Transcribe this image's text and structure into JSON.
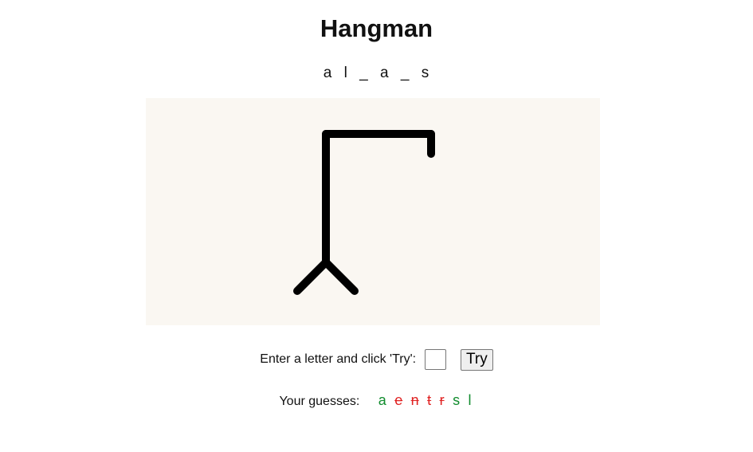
{
  "title": "Hangman",
  "word_state": [
    "a",
    "l",
    "_",
    "a",
    "_",
    "s"
  ],
  "controls": {
    "prompt": "Enter a letter and click 'Try':",
    "input_value": "",
    "try_label": "Try"
  },
  "guesses": {
    "label": "Your guesses:",
    "letters": [
      {
        "letter": "a",
        "correct": true
      },
      {
        "letter": "e",
        "correct": false
      },
      {
        "letter": "n",
        "correct": false
      },
      {
        "letter": "t",
        "correct": false
      },
      {
        "letter": "r",
        "correct": false
      },
      {
        "letter": "s",
        "correct": true
      },
      {
        "letter": "l",
        "correct": true
      }
    ]
  },
  "colors": {
    "correct": "#118c2e",
    "wrong": "#e02020",
    "board_background": "#faf7f2"
  },
  "drawing": {
    "wrong_guess_count": 4,
    "parts_shown": [
      "base",
      "pole",
      "beam",
      "rope"
    ]
  }
}
